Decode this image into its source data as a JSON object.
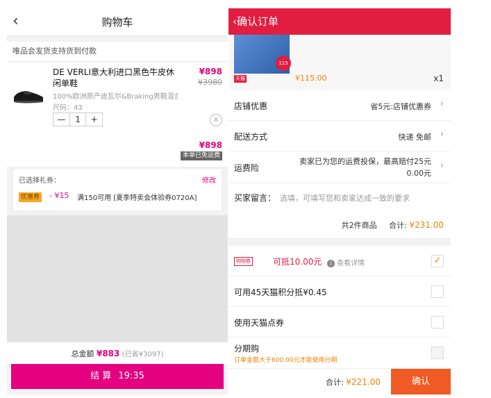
{
  "cart": {
    "title": "购物车",
    "back_icon": "‹",
    "notice": "唯品会发货支持货到付款",
    "item": {
      "name": "DE VERLI意大利进口黑色牛皮休闲单鞋",
      "price": "¥898",
      "original_price": "¥3980",
      "description": "100%欧洲原产迪瓦尔&Braking男鞋混合...",
      "size": "尺码：43",
      "quantity": "1",
      "minus": "—",
      "plus": "+",
      "remove_icon": "✕",
      "subtotal": "¥898",
      "shipping_tag": "本单已免运费"
    },
    "coupon": {
      "label": "已选择礼券：",
      "edit": "修改",
      "tag": "优惠券",
      "value": "- ¥15",
      "rule": "满150可用 [夏季特卖会体验券0720A]"
    },
    "total": {
      "label": "总金额",
      "amount": "¥883",
      "saved": "(已省¥3097)"
    },
    "checkout": {
      "label": "结 算",
      "timer": "19:35"
    }
  },
  "order": {
    "title": "确认订单",
    "back_icon": "‹",
    "product": {
      "tag": "天猫",
      "price": "¥115.00",
      "qty": "x1",
      "badge": "115"
    },
    "rows": {
      "store_discount": {
        "label": "店铺优惠",
        "value": "省5元:店铺优惠券"
      },
      "delivery": {
        "label": "配送方式",
        "value": "快递 免邮"
      },
      "shipping_insurance": {
        "label": "运费险",
        "value_line1": "卖家已为您的运费投保，最高赔付25元",
        "value_line2": "0.00元"
      },
      "message": {
        "label": "买家留言：",
        "placeholder": "选填，可填写您和卖家达成一致的要求"
      }
    },
    "summary": {
      "count": "共2件商品",
      "total_label": "合计:",
      "total": "¥231.00"
    },
    "options": {
      "shopping_voucher": {
        "tag": "购物券",
        "deduct": "可抵10.00元",
        "detail": "查看详情",
        "checked": "✓"
      },
      "tmall_points": {
        "label": "可用45天猫积分抵¥0.45"
      },
      "tmall_coins": {
        "label": "使用天猫点券"
      },
      "installment": {
        "label": "分期购",
        "note": "订单金额大于600.00元才能使用分期"
      }
    },
    "bottom": {
      "total_label": "合计:",
      "total": "¥221.00",
      "submit": "确认"
    }
  }
}
